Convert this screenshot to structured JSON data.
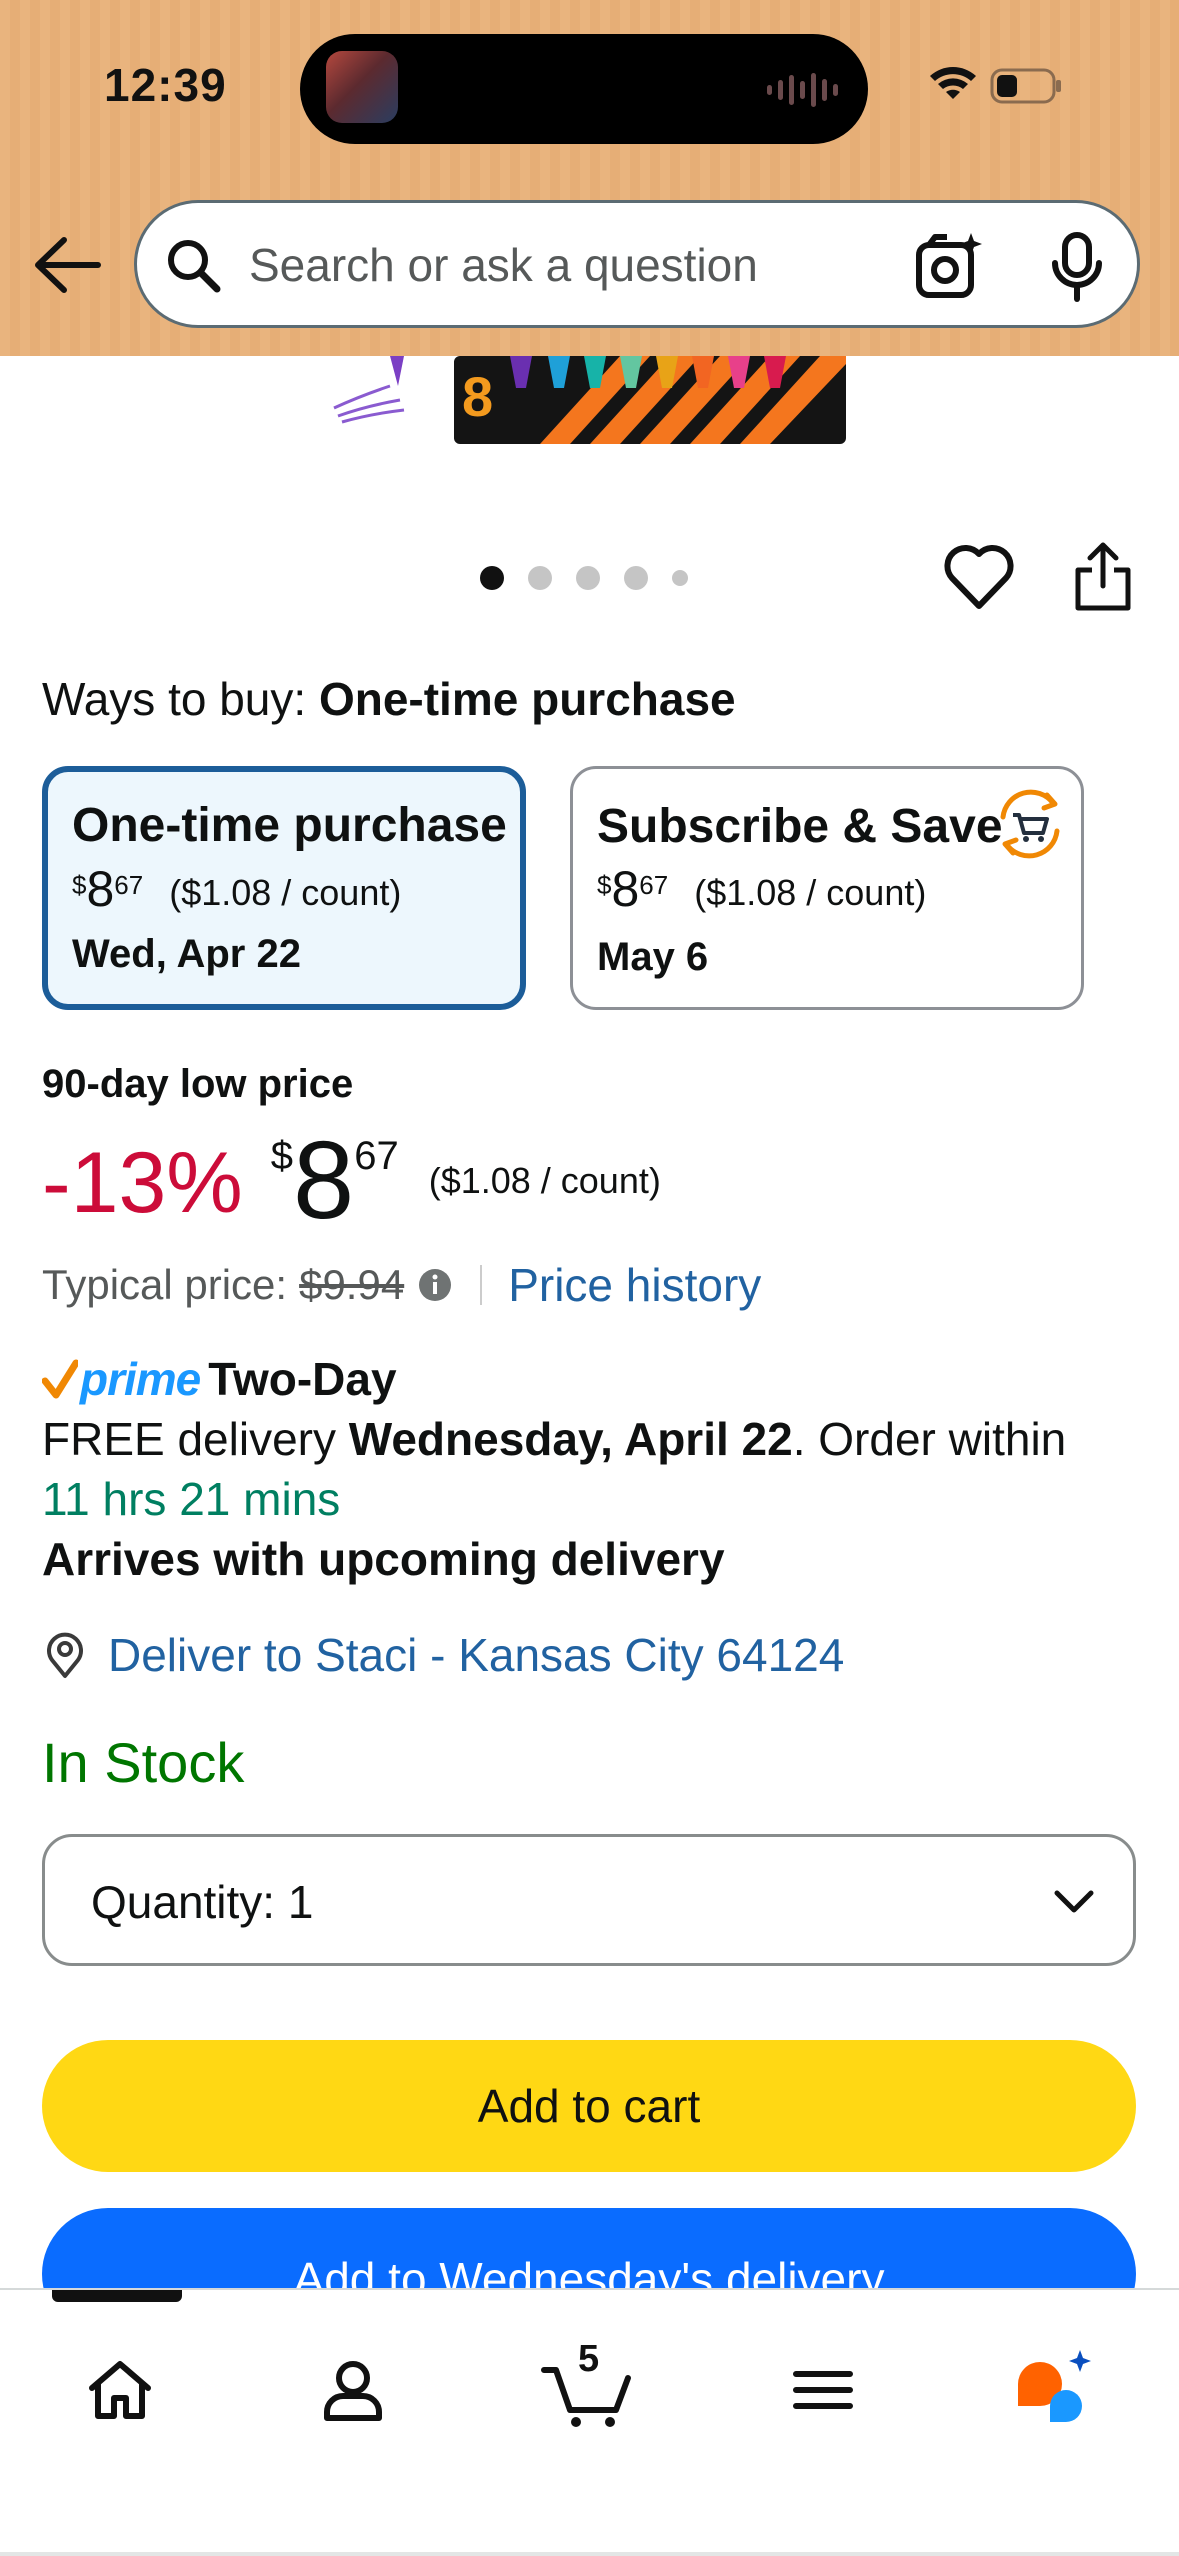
{
  "status_bar": {
    "time": "12:39"
  },
  "search": {
    "placeholder": "Search or ask a question"
  },
  "ways_to_buy": {
    "label": "Ways to buy:",
    "selected": "One-time purchase"
  },
  "options": [
    {
      "title": "One-time purchase",
      "price_symbol": "$",
      "price_whole": "8",
      "price_fraction": "67",
      "unit_price": "($1.08 / count)",
      "date": "Wed, Apr 22"
    },
    {
      "title": "Subscribe & Save",
      "price_symbol": "$",
      "price_whole": "8",
      "price_fraction": "67",
      "unit_price": "($1.08 / count)",
      "date": "May 6"
    }
  ],
  "deal": {
    "label": "90-day low price",
    "discount": "-13%",
    "price_symbol": "$",
    "price_whole": "8",
    "price_fraction": "67",
    "unit_price": "($1.08 / count)",
    "typical_label": "Typical price:",
    "typical_price": "$9.94",
    "price_history": "Price history"
  },
  "delivery": {
    "prime": "prime",
    "speed": "Two-Day",
    "free_prefix": "FREE delivery ",
    "date": "Wednesday, April 22",
    "order_within": ". Order within",
    "countdown": "11 hrs 21 mins",
    "arrives": "Arrives with upcoming delivery",
    "deliver_to": "Deliver to Staci - Kansas City 64124"
  },
  "stock": "In Stock",
  "quantity": {
    "label": "Quantity:",
    "value": "1"
  },
  "buttons": {
    "add_to_cart": "Add to cart",
    "add_to_delivery": "Add to Wednesday's delivery"
  },
  "nav": {
    "cart_count": "5"
  },
  "colors": {
    "header_bg": "#e9b47e",
    "deal_red": "#cc0c39",
    "link_blue": "#2162a1",
    "in_stock_green": "#007600",
    "countdown_green": "#007f61",
    "cart_yellow": "#ffd814",
    "delivery_blue": "#0a6cff",
    "selected_border": "#1c5d99"
  },
  "icons": [
    "back-arrow-icon",
    "search-icon",
    "camera-icon",
    "mic-icon",
    "heart-icon",
    "share-icon",
    "subscribe-cart-icon",
    "info-icon",
    "prime-check-icon",
    "location-pin-icon",
    "chevron-down-icon",
    "home-icon",
    "account-icon",
    "cart-icon",
    "menu-icon",
    "rufus-icon"
  ]
}
